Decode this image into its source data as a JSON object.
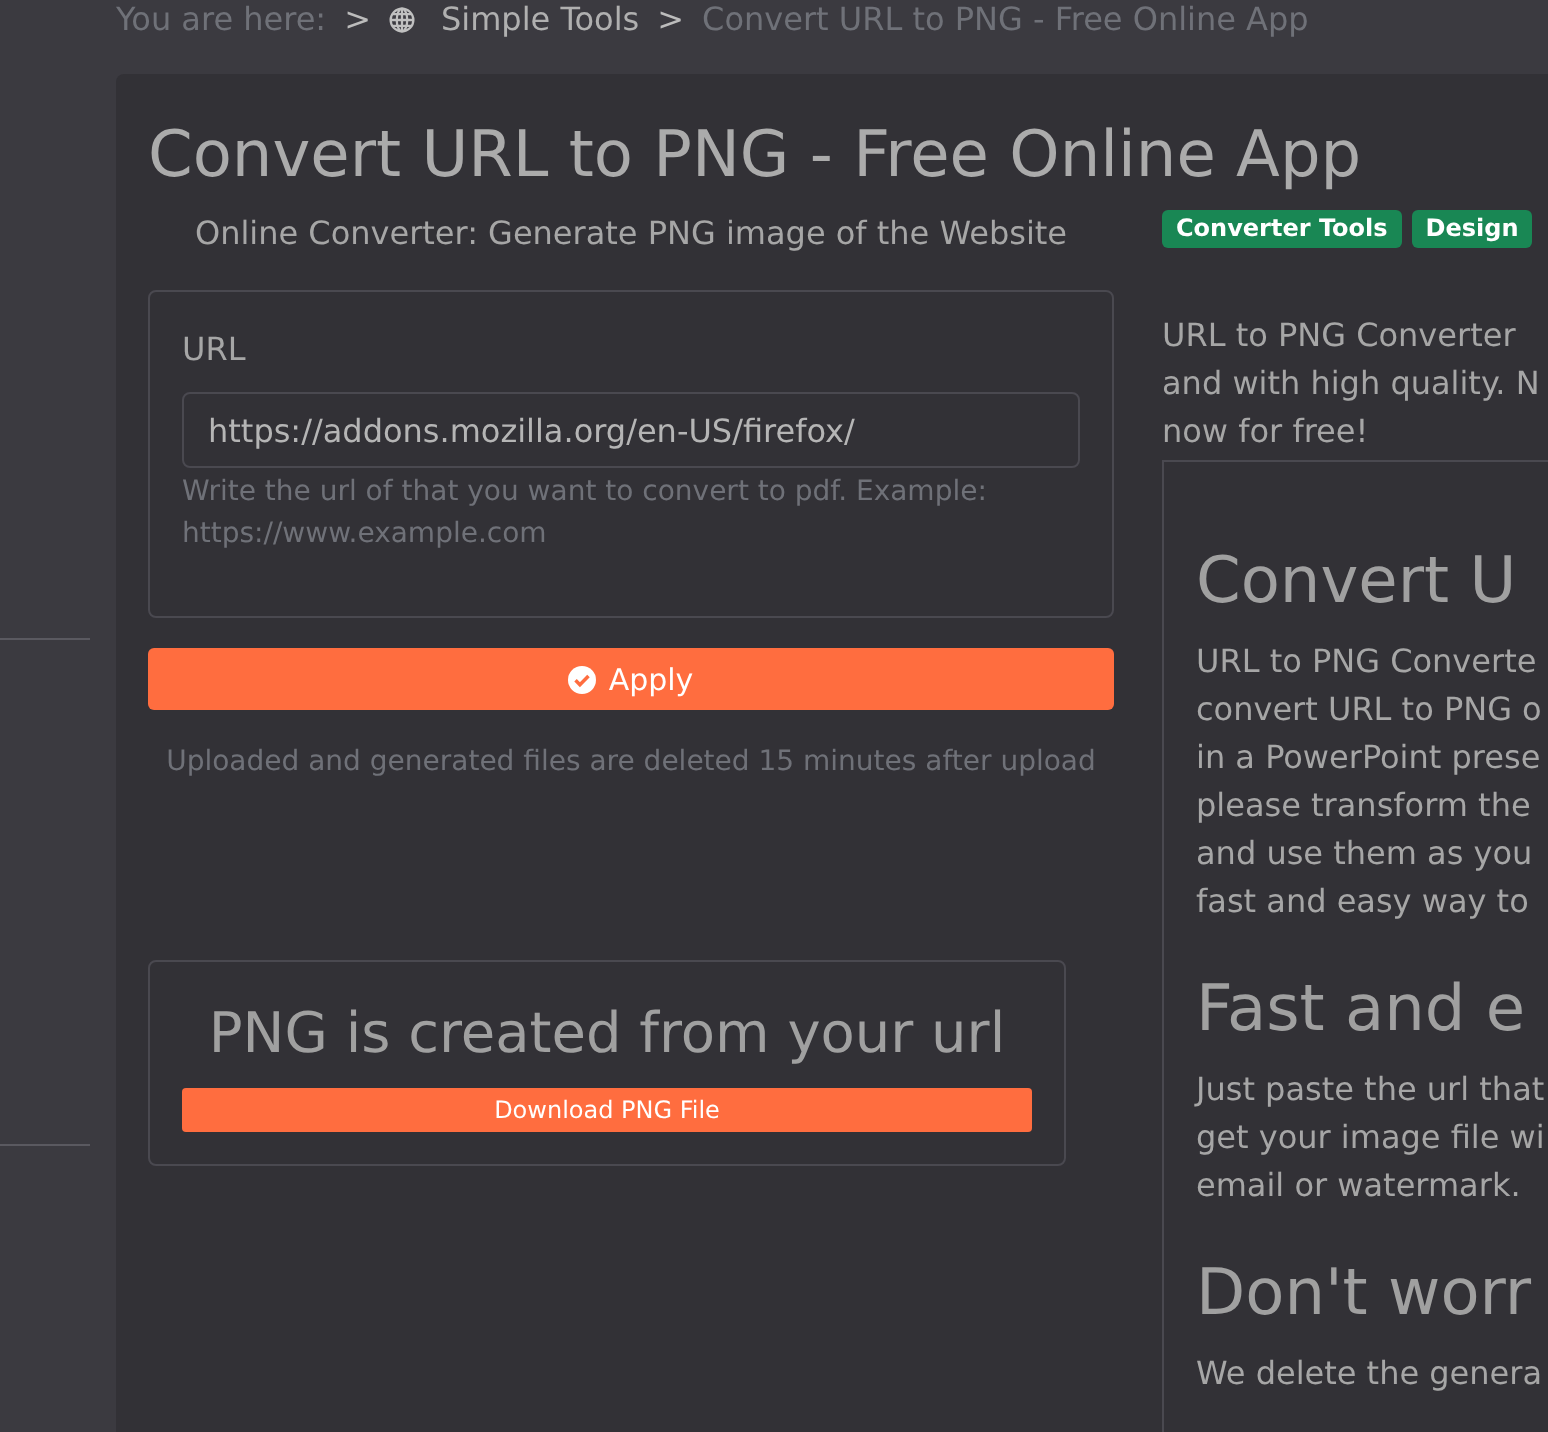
{
  "breadcrumb": {
    "label": "You are here:",
    "items": [
      {
        "kind": "separator",
        "text": ">"
      },
      {
        "kind": "link",
        "text": "Simple Tools"
      },
      {
        "kind": "separator",
        "text": ">"
      },
      {
        "kind": "current",
        "text": "Convert URL to PNG - Free Online App"
      }
    ]
  },
  "title": "Convert URL to PNG - Free Online App",
  "converter": {
    "subtitle": "Online Converter: Generate PNG image of the Website",
    "field_label": "URL",
    "value": "https://addons.mozilla.org/en-US/firefox/",
    "help": "Write the url of that you want to convert to pdf. Example: https://www.example.com",
    "button": "Apply",
    "note": "Uploaded and generated files are deleted 15 minutes after upload"
  },
  "result": {
    "heading": "PNG is created from your url",
    "button": "Download PNG File"
  },
  "tags": [
    "Converter Tools",
    "Design"
  ],
  "intro_lines": [
    "URL to PNG Converter",
    "and with high quality. N",
    "now for free!"
  ],
  "article": [
    {
      "kind": "heading",
      "lines": [
        "Convert U"
      ]
    },
    {
      "kind": "paragraph",
      "lines": [
        "URL to PNG Converte",
        "convert URL to PNG o",
        "in a PowerPoint prese",
        "please transform the",
        "and use them as you",
        "fast and easy way to"
      ]
    },
    {
      "kind": "heading",
      "lines": [
        "Fast and e"
      ]
    },
    {
      "kind": "paragraph",
      "lines": [
        "Just paste the url that",
        "get your image file wi",
        "email or watermark."
      ]
    },
    {
      "kind": "heading",
      "lines": [
        "Don't worr"
      ]
    },
    {
      "kind": "paragraph",
      "lines": [
        "We delete the genera"
      ]
    }
  ]
}
